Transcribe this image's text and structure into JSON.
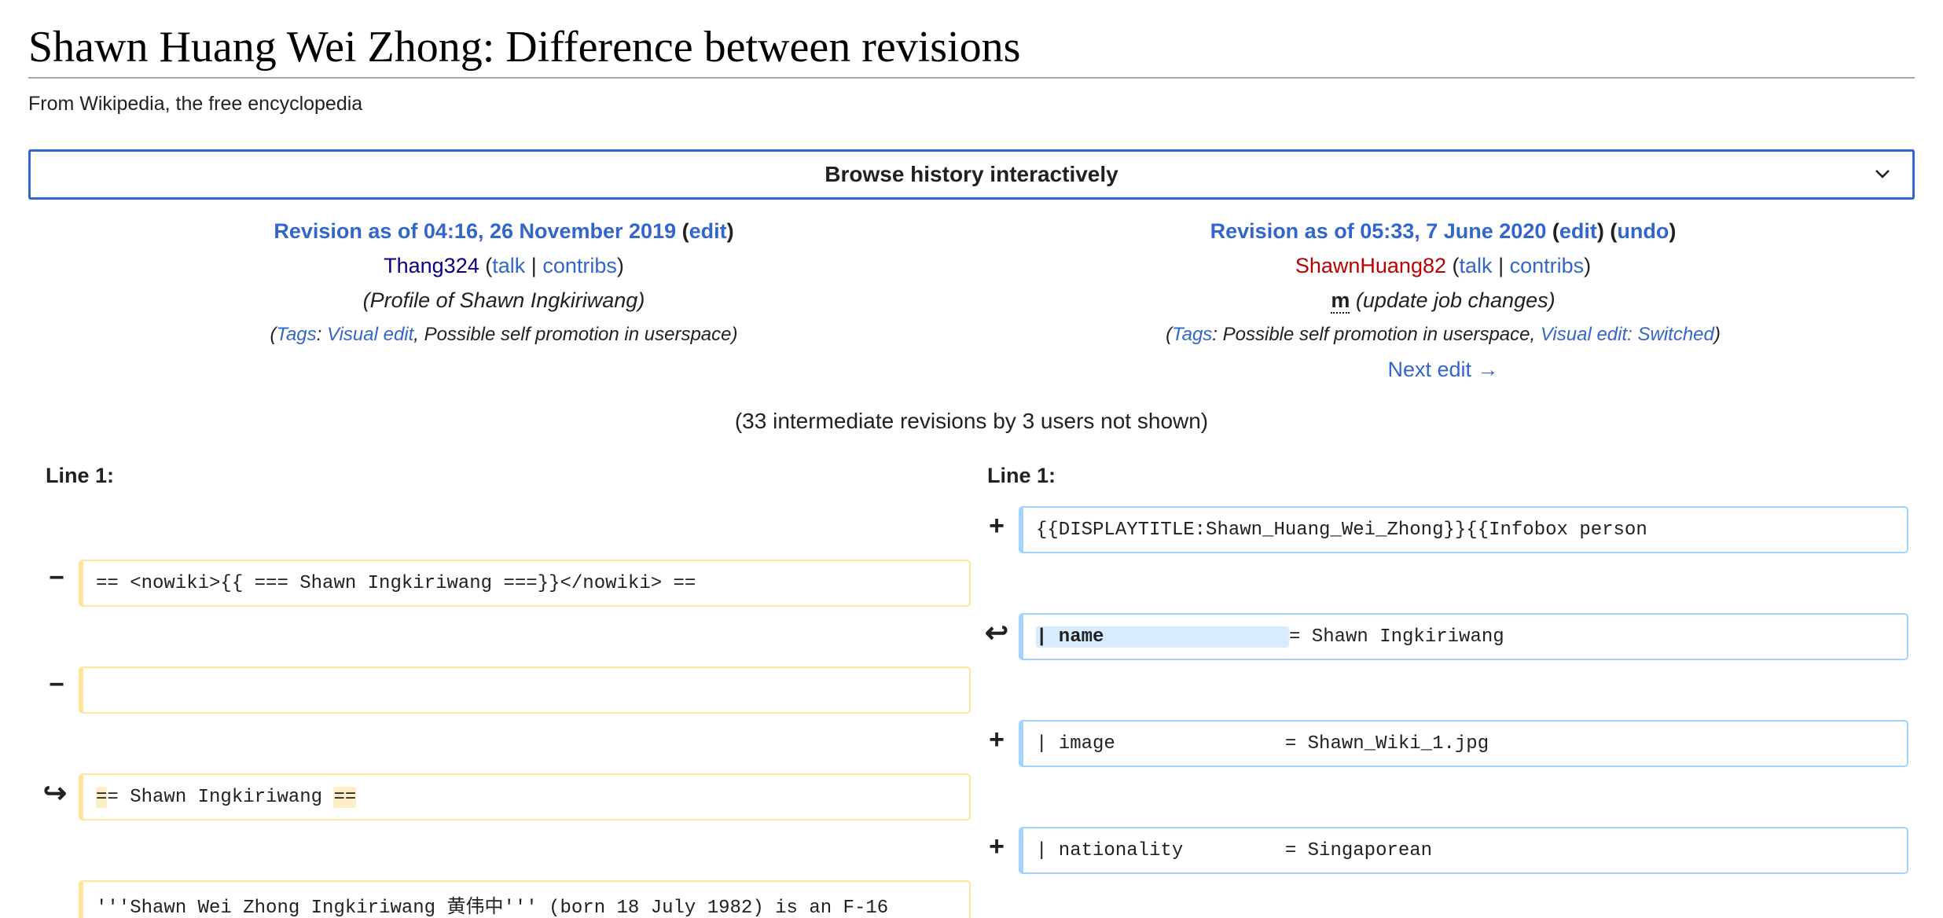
{
  "page": {
    "title": "Shawn Huang Wei Zhong: Difference between revisions",
    "tagline": "From Wikipedia, the free encyclopedia"
  },
  "browse": {
    "label": "Browse history interactively",
    "icon": "chevron-down-icon"
  },
  "old_rev": {
    "title": "Revision as of 04:16, 26 November 2019",
    "edit": "edit",
    "user": "Thang324",
    "talk": "talk",
    "sep": "|",
    "contribs": "contribs",
    "summary": "(Profile of Shawn Ingkiriwang)",
    "tags_label": "Tags",
    "tag1": "Visual edit",
    "tag2": ", Possible self promotion in userspace"
  },
  "new_rev": {
    "title": "Revision as of 05:33, 7 June 2020",
    "edit": "edit",
    "undo": "undo",
    "user": "ShawnHuang82",
    "talk": "talk",
    "sep": "|",
    "contribs": "contribs",
    "minor": "m",
    "summary": "(update job changes)",
    "tags_label": "Tags",
    "tag1": ": Possible self promotion in userspace, ",
    "tag2": "Visual edit: Switched",
    "next": "Next edit →"
  },
  "intermediate": "(33 intermediate revisions by 3 users not shown)",
  "diff": {
    "left_lineno": "Line 1:",
    "right_lineno": "Line 1:",
    "rows": {
      "r1_right": "{{DISPLAYTITLE:Shawn_Huang_Wei_Zhong}}{{Infobox person",
      "r2_left": "== <nowiki>{{ === Shawn Ingkiriwang ===}}</nowiki> ==",
      "r3_right_hl": "| name",
      "r3_right_rest": "= Shawn Ingkiriwang",
      "r5_right": "| image               = Shawn_Wiki_1.jpg",
      "r6_left_a": "=",
      "r6_left_b": "= Shawn Ingkiriwang ",
      "r6_left_c": "==",
      "r7_right": "| nationality         = Singaporean",
      "r8_left": "'''Shawn Wei Zhong Ingkiriwang 黄伟中''' (born 18 July 1982) is an F-16"
    },
    "markers": {
      "add": "+",
      "del": "−",
      "moved_in": "↩",
      "moved_out": "↪"
    }
  },
  "colors": {
    "link": "#3366cc",
    "visited": "#0b0080",
    "new": "#ba0000",
    "del_border": "#ffe49c",
    "add_border": "#a3d3ff"
  }
}
